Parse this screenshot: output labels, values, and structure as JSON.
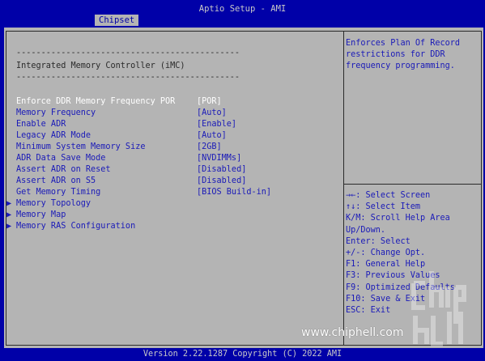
{
  "header": {
    "title": "Aptio Setup - AMI",
    "tab": "Chipset"
  },
  "main": {
    "separator": "---------------------------------------------",
    "section_title": "Integrated Memory Controller (iMC)",
    "settings": [
      {
        "label": "Enforce DDR Memory Frequency POR",
        "value": "[POR]",
        "selected": true
      },
      {
        "label": "Memory Frequency",
        "value": "[Auto]"
      },
      {
        "label": "Enable ADR",
        "value": "[Enable]"
      },
      {
        "label": "Legacy ADR Mode",
        "value": "[Auto]"
      },
      {
        "label": "Minimum System Memory Size",
        "value": "[2GB]"
      },
      {
        "label": "ADR Data Save Mode",
        "value": "[NVDIMMs]"
      },
      {
        "label": "Assert ADR on Reset",
        "value": "[Disabled]"
      },
      {
        "label": "Assert ADR on S5",
        "value": "[Disabled]"
      },
      {
        "label": "Get Memory Timing",
        "value": "[BIOS Build-in]"
      }
    ],
    "submenus": [
      {
        "label": "Memory Topology"
      },
      {
        "label": "Memory Map"
      },
      {
        "label": "Memory RAS Configuration"
      }
    ],
    "submenu_arrow": "▶"
  },
  "help": {
    "lines": [
      "Enforces Plan Of Record",
      "restrictions for DDR",
      "frequency programming."
    ]
  },
  "keys": {
    "lines": [
      "→←: Select Screen",
      "↑↓: Select Item",
      "K/M: Scroll Help Area",
      "Up/Down.",
      "Enter: Select",
      "+/-: Change Opt.",
      "F1: General Help",
      "F3: Previous Values",
      "F9: Optimized Defaults",
      "F10: Save & Exit",
      "ESC: Exit"
    ]
  },
  "footer": {
    "text": "Version 2.22.1287 Copyright (C) 2022 AMI"
  },
  "watermark": {
    "text": "www.chiphell.com"
  }
}
